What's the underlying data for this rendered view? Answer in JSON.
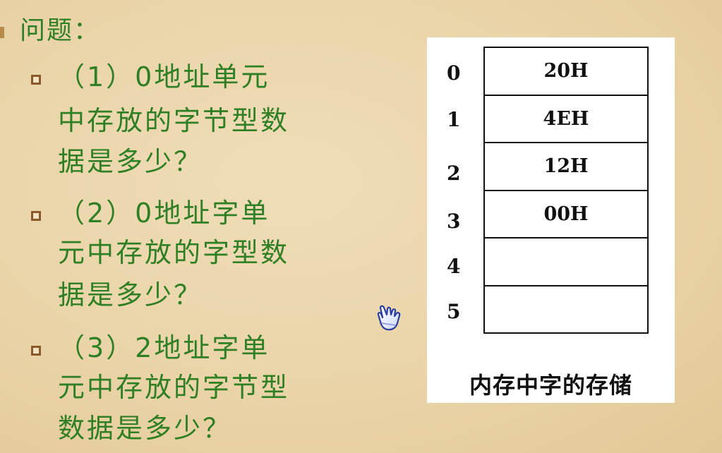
{
  "heading": "问题：",
  "questions": [
    {
      "lines": [
        "（1）0地址单元",
        "中存放的字节型数",
        "据是多少？"
      ]
    },
    {
      "lines": [
        "（2）0地址字单",
        "元中存放的字型数",
        "据是多少？"
      ]
    },
    {
      "lines": [
        "（3）2地址字单",
        "元中存放的字节型",
        "数据是多少？"
      ]
    }
  ],
  "memory": {
    "addresses": [
      "0",
      "1",
      "2",
      "3",
      "4",
      "5"
    ],
    "values": [
      "20H",
      "4EH",
      "12H",
      "00H",
      "",
      ""
    ],
    "caption": "内存中字的存储"
  },
  "icons": {
    "cursor": "hand-pointer-icon"
  },
  "colors": {
    "background": "#ead4a8",
    "text_green": "#2f7f24",
    "bullet_brown": "#8a5a2a"
  }
}
